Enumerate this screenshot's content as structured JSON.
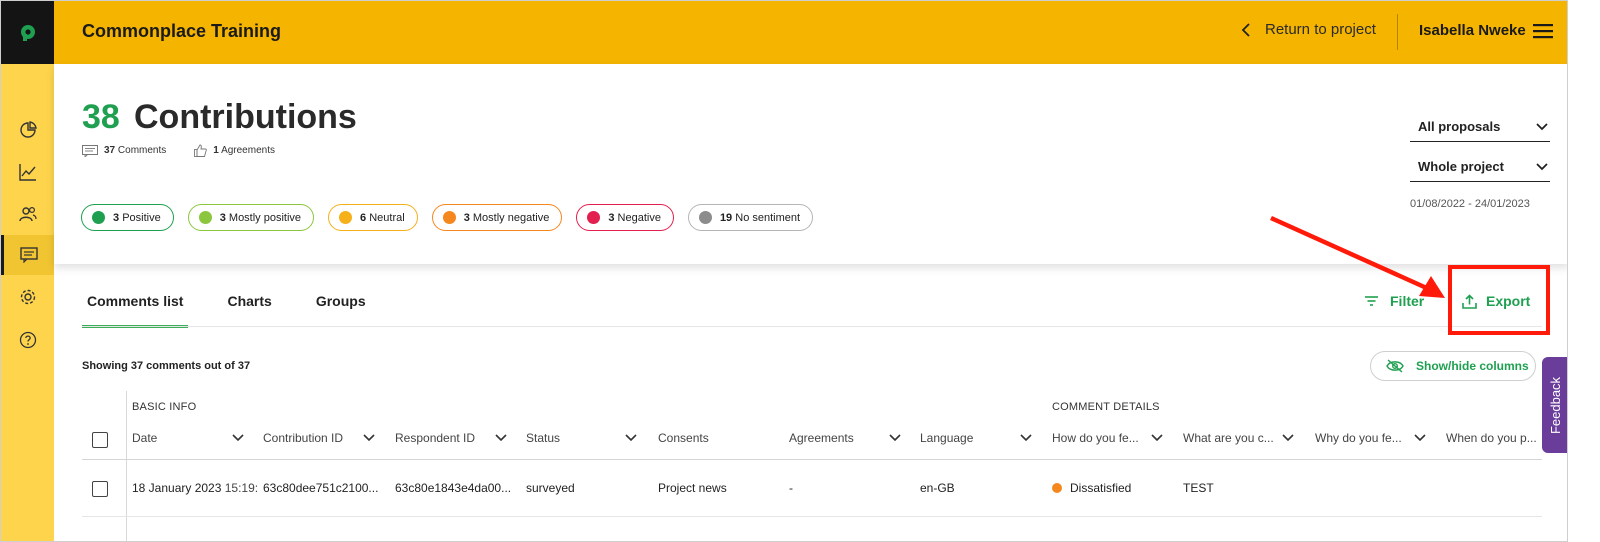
{
  "topbar": {
    "app_title": "Commonplace Training",
    "return_label": "Return to project",
    "user_name": "Isabella Nweke"
  },
  "header": {
    "count": "38",
    "title": "Contributions",
    "comments_count": "37",
    "comments_label": "Comments",
    "agreements_count": "1",
    "agreements_label": "Agreements"
  },
  "sentiments": [
    {
      "count": "3",
      "label": "Positive",
      "color": "#1fa050",
      "border": "#1fa050"
    },
    {
      "count": "3",
      "label": "Mostly positive",
      "color": "#8cc63e",
      "border": "#8cc63e"
    },
    {
      "count": "6",
      "label": "Neutral",
      "color": "#f5b01a",
      "border": "#f5b01a"
    },
    {
      "count": "3",
      "label": "Mostly negative",
      "color": "#f5871f",
      "border": "#f5871f"
    },
    {
      "count": "3",
      "label": "Negative",
      "color": "#e21f4f",
      "border": "#e21f4f"
    },
    {
      "count": "19",
      "label": "No sentiment",
      "color": "#8c8c8c",
      "border": "#b5b5b5"
    }
  ],
  "filters": {
    "proposals": "All proposals",
    "scope": "Whole project",
    "date_range": "01/08/2022 - 24/01/2023"
  },
  "tabs": [
    "Comments list",
    "Charts",
    "Groups"
  ],
  "actions": {
    "filter": "Filter",
    "export": "Export",
    "show_hide": "Show/hide columns"
  },
  "table": {
    "showing": "Showing 37 comments out of 37",
    "groups": [
      "BASIC INFO",
      "COMMENT DETAILS"
    ],
    "columns": [
      "Date",
      "Contribution ID",
      "Respondent ID",
      "Status",
      "Consents",
      "Agreements",
      "Language",
      "How do you fe...",
      "What are you c...",
      "Why do you fe...",
      "When do you p..."
    ],
    "rows": [
      {
        "date": "18 January 2023",
        "time": "15:19:",
        "contribution_id": "63c80dee751c2100...",
        "respondent_id": "63c80e1843e4da00...",
        "status": "surveyed",
        "consents": "Project news",
        "agreements": "-",
        "language": "en-GB",
        "feeling": "Dissatisfied",
        "feeling_color": "#f5871f",
        "what": "TEST"
      }
    ]
  },
  "feedback": "Feedback",
  "colors": {
    "topbar": "#f4b400",
    "sidenav": "#fdd44c",
    "accent_green": "#1fa050",
    "annotation_red": "#ff1a0a"
  }
}
